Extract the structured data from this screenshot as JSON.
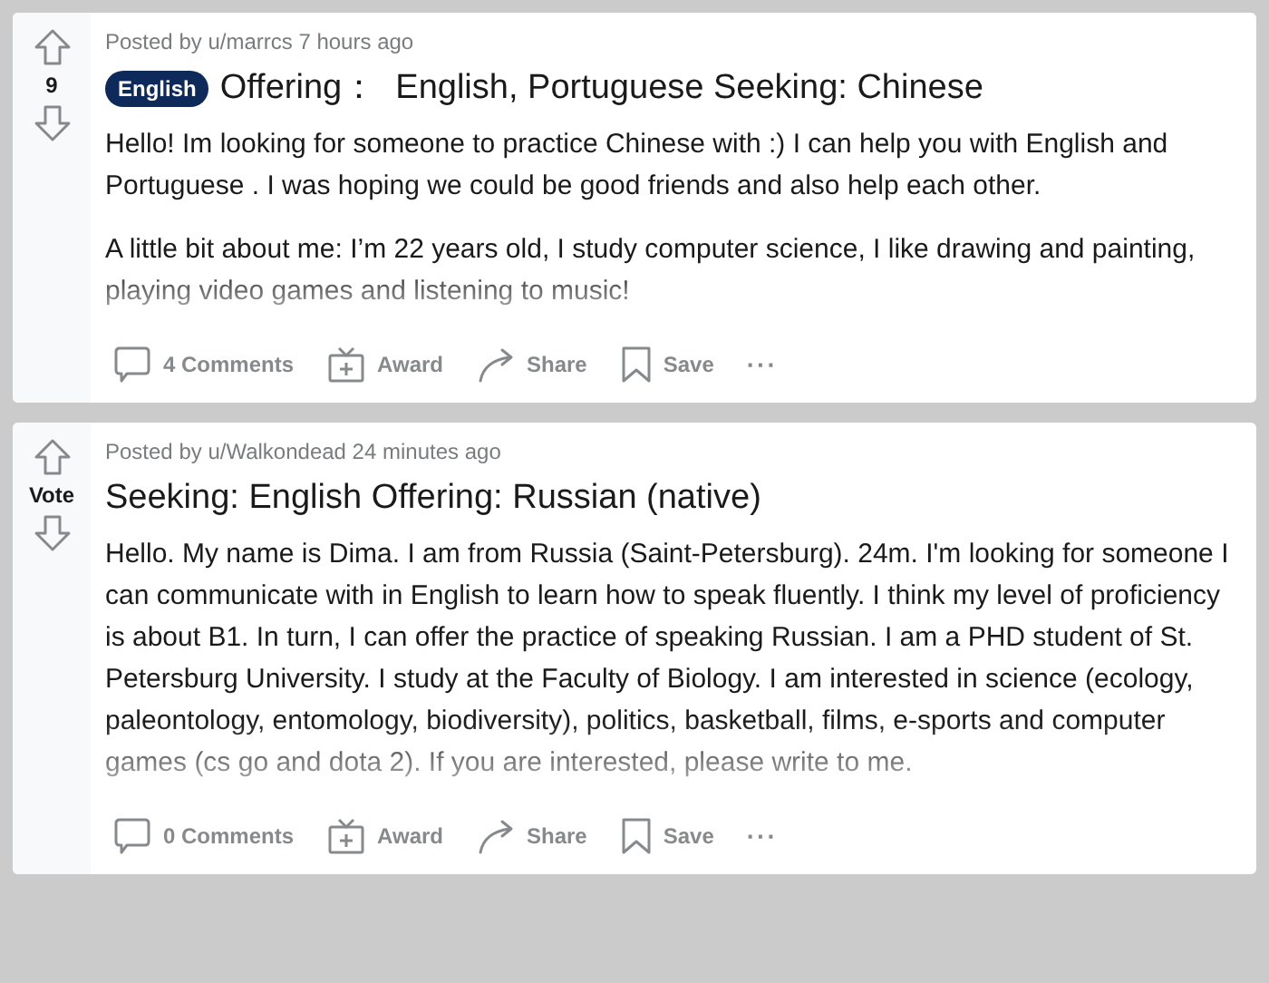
{
  "posts": [
    {
      "score": "9",
      "meta": "Posted by u/marrcs 7 hours ago",
      "flair": "English",
      "title": "Offering：  English, Portuguese Seeking: Chinese",
      "paragraphs": [
        "Hello! Im looking for someone to practice Chinese with :) I can help you with English and Portuguese . I was hoping we could be good friends and also help each other.",
        "A little bit about me: I’m 22 years old, I study computer science, I like drawing and painting, playing video games and listening to music!"
      ],
      "actions": [
        {
          "kind": "comments",
          "label": "4 Comments"
        },
        {
          "kind": "award",
          "label": "Award"
        },
        {
          "kind": "share",
          "label": "Share"
        },
        {
          "kind": "save",
          "label": "Save"
        },
        {
          "kind": "more",
          "label": "···"
        }
      ]
    },
    {
      "score": "Vote",
      "meta": "Posted by u/Walkondead 24 minutes ago",
      "title": "Seeking: English Offering: Russian (native)",
      "paragraphs": [
        "Hello. My name is Dima. I am from Russia (Saint-Petersburg). 24m. I'm looking for someone I can communicate with in English to learn how to speak fluently. I think my level of proficiency is about B1. In turn, I can offer the practice of speaking Russian. I am a PHD student of St. Petersburg University. I study at the Faculty of Biology. I am interested in science (ecology, paleontology, entomology, biodiversity), politics, basketball, films, e-sports and computer games (cs go and dota 2). If you are interested, please write to me."
      ],
      "actions": [
        {
          "kind": "comments",
          "label": "0 Comments"
        },
        {
          "kind": "award",
          "label": "Award"
        },
        {
          "kind": "share",
          "label": "Share"
        },
        {
          "kind": "save",
          "label": "Save"
        },
        {
          "kind": "more",
          "label": "···"
        }
      ]
    }
  ]
}
